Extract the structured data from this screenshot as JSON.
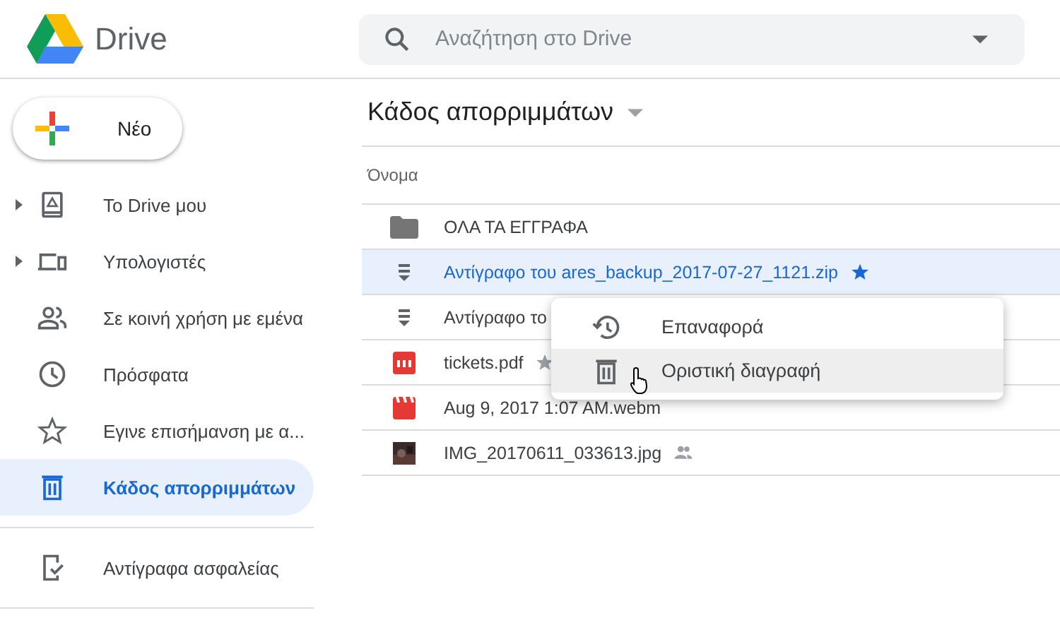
{
  "app": {
    "name": "Drive"
  },
  "search": {
    "placeholder": "Αναζήτηση στο Drive"
  },
  "new_button": {
    "label": "Νέο"
  },
  "sidebar": {
    "items": [
      {
        "label": "Το Drive μου",
        "kind": "drive",
        "expandable": true,
        "selected": false
      },
      {
        "label": "Υπολογιστές",
        "kind": "computers",
        "expandable": true,
        "selected": false
      },
      {
        "label": "Σε κοινή χρήση με εμένα",
        "kind": "shared",
        "expandable": false,
        "selected": false
      },
      {
        "label": "Πρόσφατα",
        "kind": "recent",
        "expandable": false,
        "selected": false
      },
      {
        "label": "Εγινε επισήμανση με α...",
        "kind": "starred",
        "expandable": false,
        "selected": false
      },
      {
        "label": "Κάδος απορριμμάτων",
        "kind": "trash",
        "expandable": false,
        "selected": true
      }
    ],
    "secondary_items": [
      {
        "label": "Αντίγραφα ασφαλείας",
        "kind": "backup"
      }
    ]
  },
  "main": {
    "title": "Κάδος απορριμμάτων",
    "column_header": "Όνομα",
    "rows": [
      {
        "name": "ΟΛΑ ΤΑ ΕΓΓΡΑΦΑ",
        "kind": "folder",
        "starred": false,
        "shared": false,
        "selected": false
      },
      {
        "name": "Αντίγραφο του ares_backup_2017-07-27_1121.zip",
        "kind": "zip",
        "starred": true,
        "shared": false,
        "selected": true
      },
      {
        "name": "Αντίγραφο το",
        "kind": "zip",
        "selected": false
      },
      {
        "name": "tickets.pdf",
        "kind": "pdf",
        "starred": true,
        "shared": false,
        "selected": false
      },
      {
        "name": "Aug 9, 2017 1:07 AM.webm",
        "kind": "video",
        "starred": false,
        "shared": false,
        "selected": false
      },
      {
        "name": "IMG_20170611_033613.jpg",
        "starred": false,
        "shared": true,
        "selected": false
      }
    ]
  },
  "context_menu": {
    "items": [
      {
        "label": "Επαναφορά",
        "kind": "restore",
        "hovered": false
      },
      {
        "label": "Οριστική διαγραφή",
        "kind": "delete",
        "hovered": true
      }
    ]
  }
}
